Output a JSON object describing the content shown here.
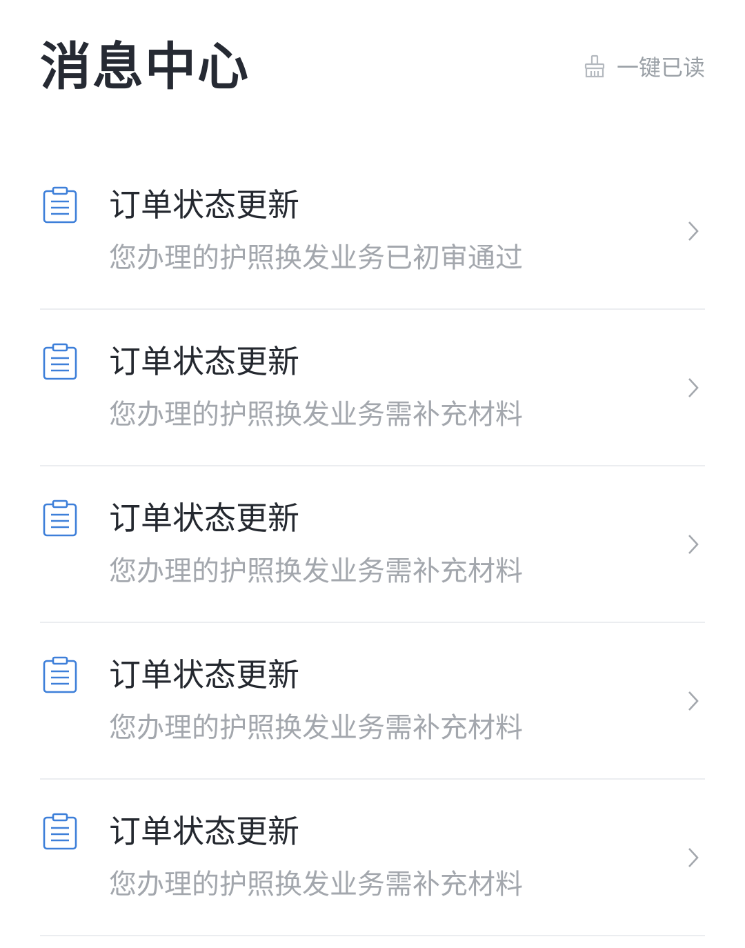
{
  "header": {
    "title": "消息中心",
    "mark_all_read": {
      "icon": "broom-icon",
      "label": "一键已读"
    }
  },
  "messages": [
    {
      "icon": "clipboard-icon",
      "title": "订单状态更新",
      "desc": "您办理的护照换发业务已初审通过"
    },
    {
      "icon": "clipboard-icon",
      "title": "订单状态更新",
      "desc": "您办理的护照换发业务需补充材料"
    },
    {
      "icon": "clipboard-icon",
      "title": "订单状态更新",
      "desc": "您办理的护照换发业务需补充材料"
    },
    {
      "icon": "clipboard-icon",
      "title": "订单状态更新",
      "desc": "您办理的护照换发业务需补充材料"
    },
    {
      "icon": "clipboard-icon",
      "title": "订单状态更新",
      "desc": "您办理的护照换发业务需补充材料"
    }
  ],
  "colors": {
    "accent": "#3d7fd9",
    "title_text": "#262a33",
    "secondary_text": "#a3a7ad",
    "divider": "#ebedf0"
  }
}
